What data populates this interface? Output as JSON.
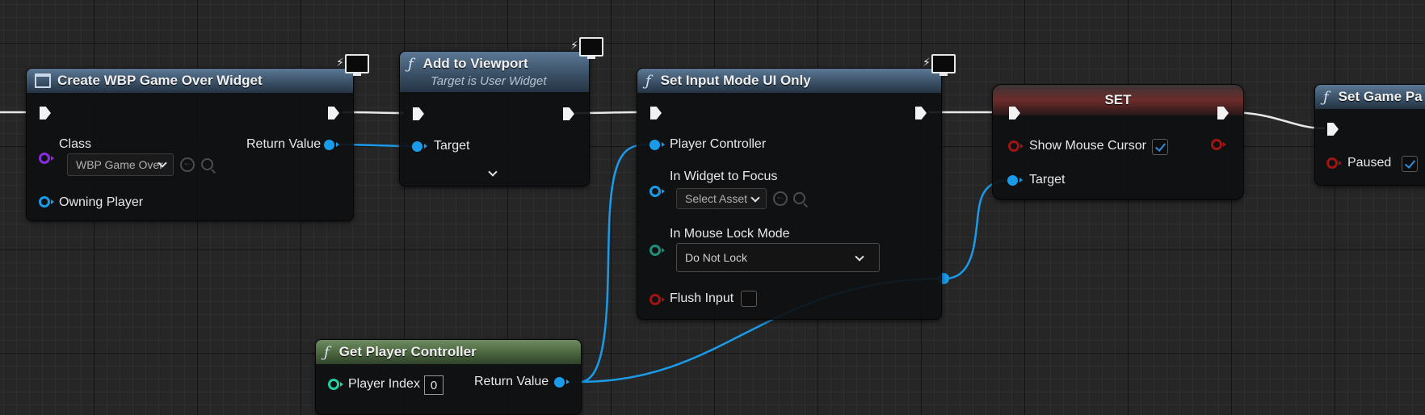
{
  "colors": {
    "exec": "#f2f2f2",
    "object_pin": "#1a9bea",
    "class_pin": "#8a2be2",
    "bool_pin": "#a11414",
    "byte_pin": "#1c8f7c",
    "int_pin": "#1fd2a0",
    "checkbox_check": "#2e8fe0"
  },
  "nodes": {
    "create_widget": {
      "title": "Create WBP Game Over Widget",
      "icon": "widget-class-icon",
      "class_label": "Class",
      "class_value": "WBP Game Over",
      "owning_player_label": "Owning Player",
      "return_label": "Return Value"
    },
    "add_to_viewport": {
      "title": "Add to Viewport",
      "subtitle": "Target is User Widget",
      "target_label": "Target"
    },
    "set_input_mode": {
      "title": "Set Input Mode UI Only",
      "player_controller_label": "Player Controller",
      "widget_focus_label": "In Widget to Focus",
      "widget_focus_value": "Select Asset",
      "mouse_lock_label": "In Mouse Lock Mode",
      "mouse_lock_value": "Do Not Lock",
      "flush_input_label": "Flush Input",
      "flush_input_checked": false
    },
    "set_var": {
      "title": "SET",
      "show_cursor_label": "Show Mouse Cursor",
      "show_cursor_checked": true,
      "target_label": "Target"
    },
    "set_game_paused": {
      "title": "Set Game Pa",
      "paused_label": "Paused",
      "paused_checked": true
    },
    "get_player_controller": {
      "title": "Get Player Controller",
      "player_index_label": "Player Index",
      "player_index_value": "0",
      "return_label": "Return Value"
    }
  }
}
